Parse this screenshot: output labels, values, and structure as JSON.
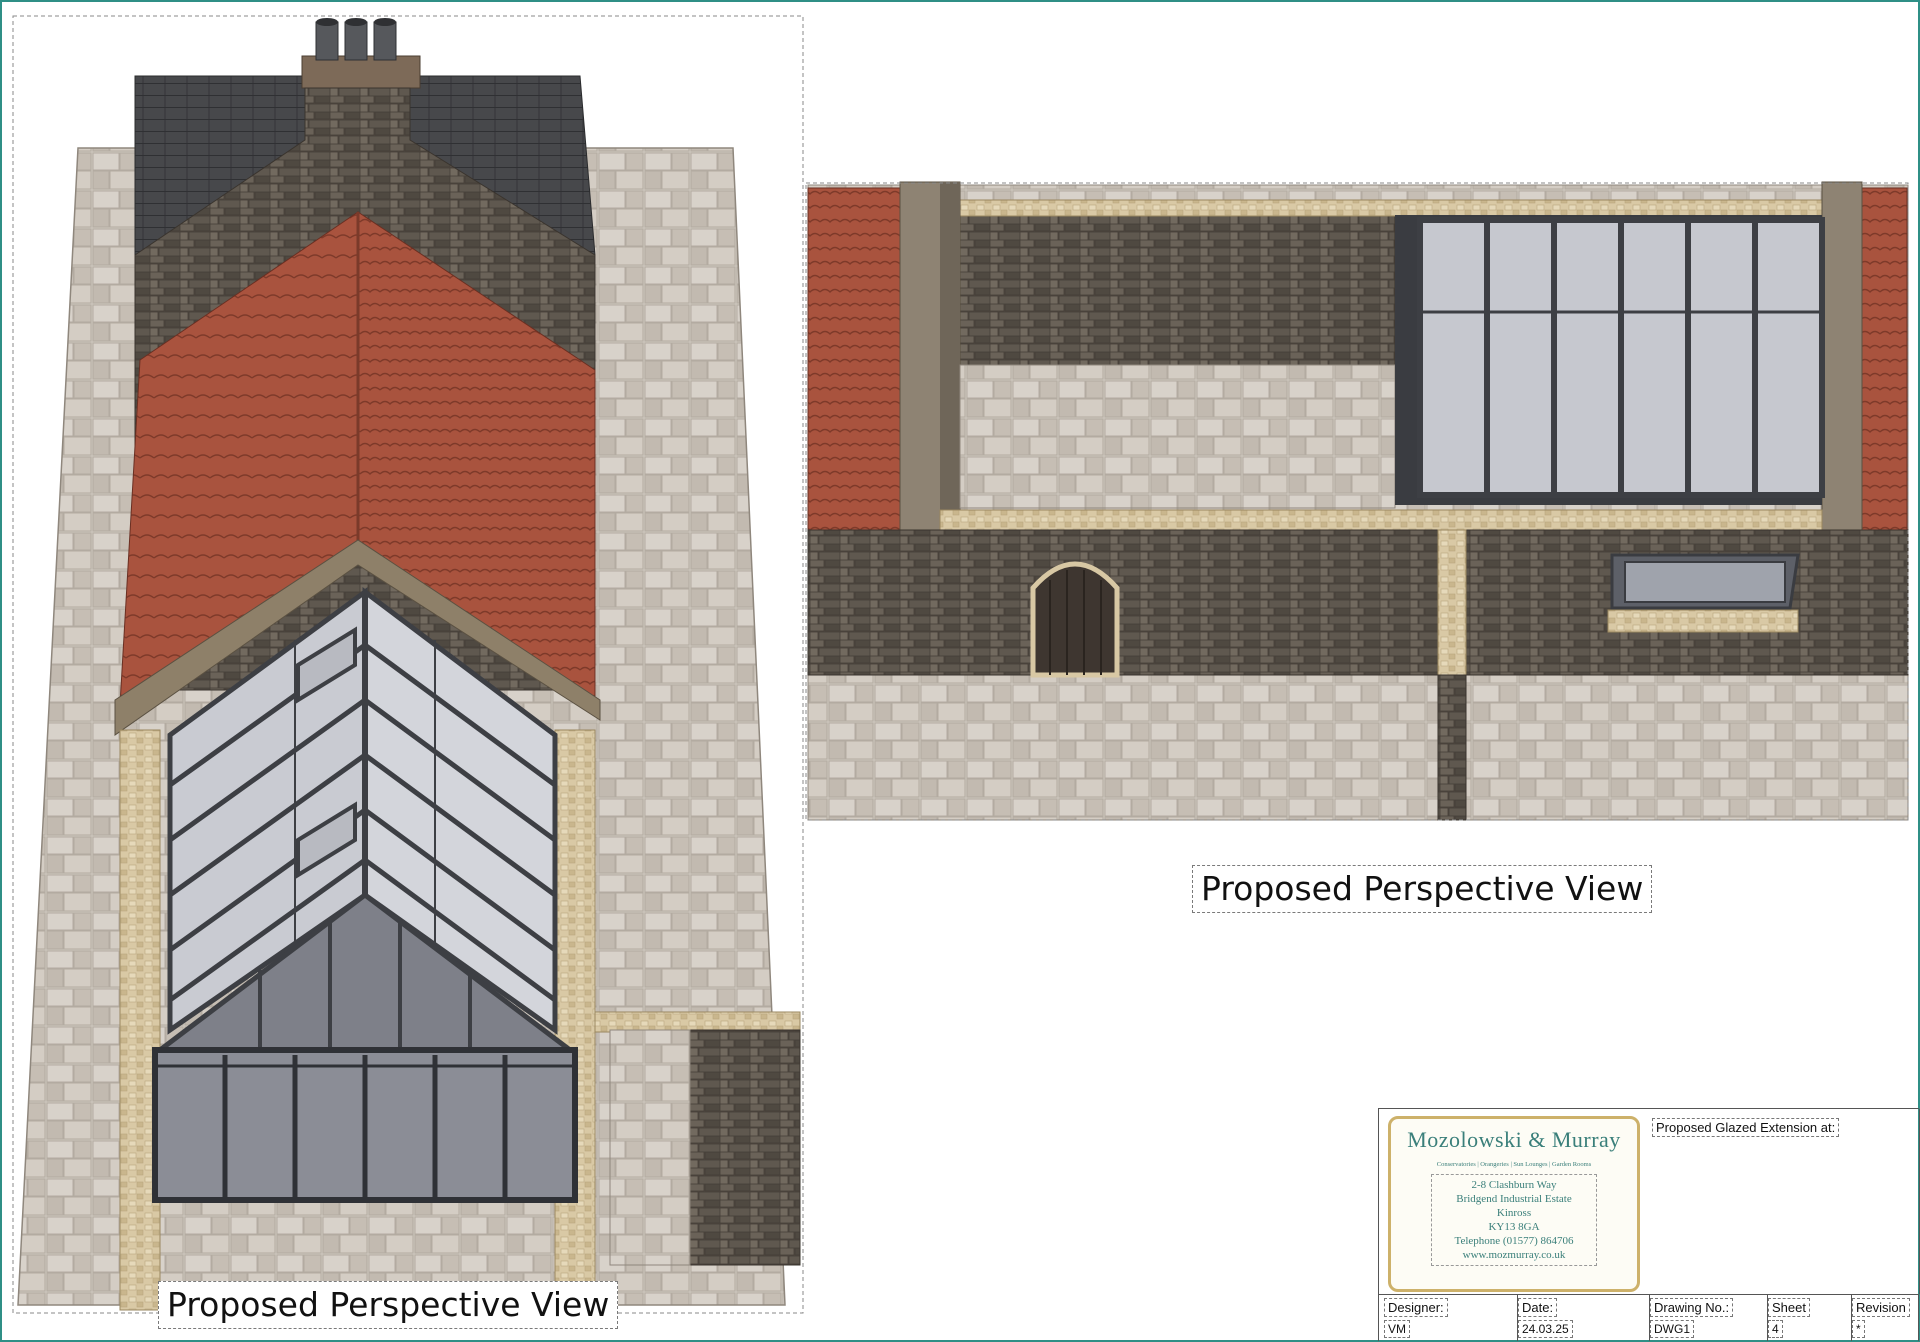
{
  "views": {
    "left_caption": "Proposed Perspective View",
    "right_caption": "Proposed Perspective View"
  },
  "company": {
    "name": "Mozolowski & Murray",
    "tagline": "Conservatories | Orangeries | Sun Lounges | Garden Rooms",
    "address_lines": [
      "2-8 Clashburn Way",
      "Bridgend Industrial Estate",
      "Kinross",
      "KY13 8GA",
      "Telephone (01577) 864706",
      "www.mozmurray.co.uk"
    ]
  },
  "title_block": {
    "project_label": "Proposed Glazed Extension at:",
    "designer_label": "Designer:",
    "designer_value": "VM",
    "date_label": "Date:",
    "date_value": "24.03.25",
    "drawing_no_label": "Drawing No.:",
    "drawing_no_value": "DWG1",
    "sheet_label": "Sheet",
    "sheet_value": "4",
    "revision_label": "Revision",
    "revision_value": "*"
  },
  "colors": {
    "frame": "#2f8f86",
    "slate_roof": "#4a4b4e",
    "clay_roof": "#a9533e",
    "stone_wall": "#5e574f",
    "paving": "#cdc6bd",
    "glass": "#c9cbd2",
    "frame_metal": "#3d3f44",
    "sandstone": "#d8c8a4",
    "logo_teal": "#3a7f7a",
    "logo_gold": "#cdb16a"
  }
}
